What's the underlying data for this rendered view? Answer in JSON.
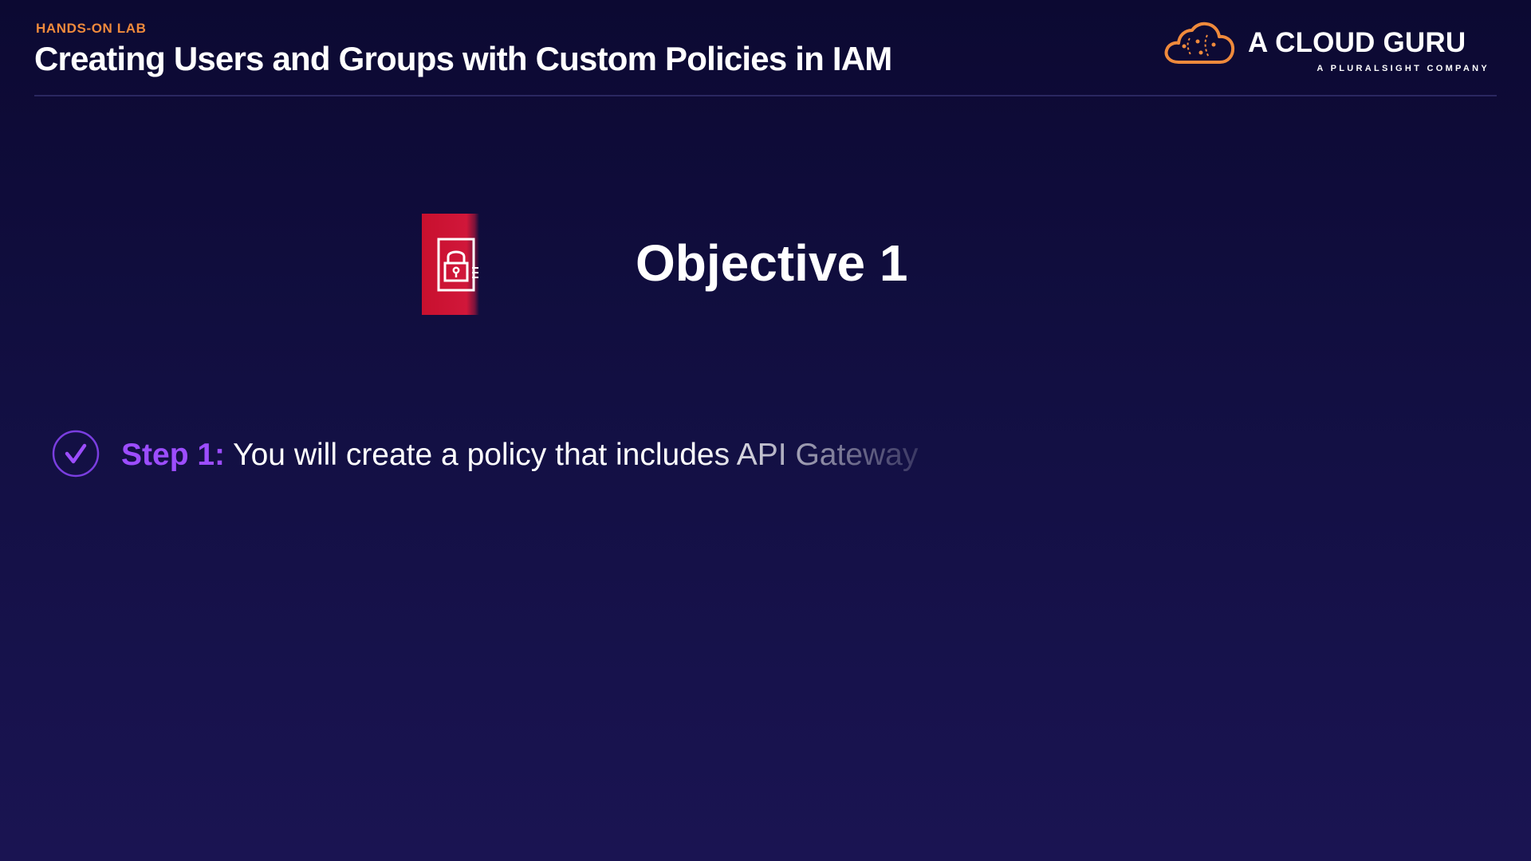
{
  "header": {
    "eyebrow": "HANDS-ON LAB",
    "title": "Creating Users and Groups with Custom Policies in IAM"
  },
  "brand": {
    "name": "A CLOUD GURU",
    "tagline": "A PLURALSIGHT COMPANY",
    "logo_icon": "cloud-logo-icon",
    "accent_color": "#ef8a3c"
  },
  "objective": {
    "icon": "iam-lock-icon",
    "icon_color": "#c8102e",
    "title": "Objective 1"
  },
  "steps": [
    {
      "icon": "checkmark-circle-icon",
      "label": "Step 1:",
      "text": "You will create a policy that includes API Gateway",
      "label_color": "#9c4dff"
    }
  ]
}
